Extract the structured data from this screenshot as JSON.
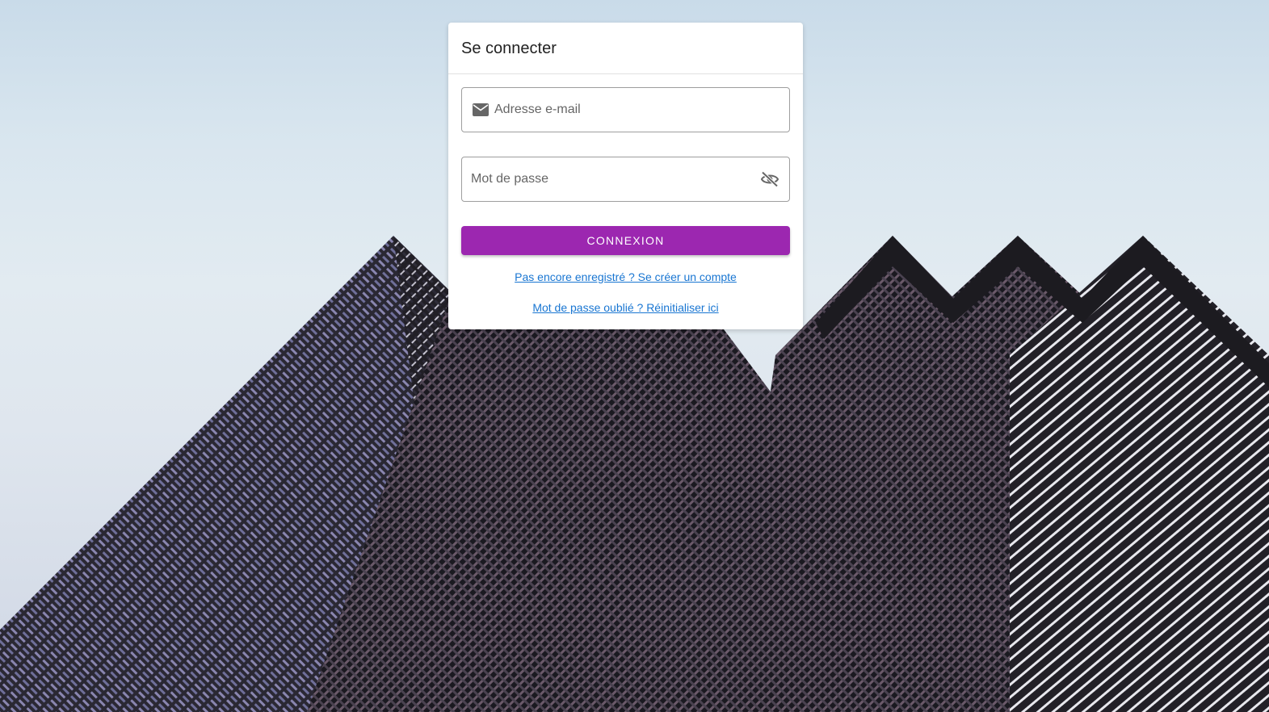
{
  "login": {
    "title": "Se connecter",
    "email_placeholder": "Adresse e-mail",
    "email_value": "",
    "password_placeholder": "Mot de passe",
    "password_value": "",
    "submit_label": "CONNEXION",
    "register_link": "Pas encore enregistré ? Se créer un compte",
    "reset_link": "Mot de passe oublié ? Réinitialiser ici"
  },
  "icons": {
    "email": "mail-icon",
    "password_toggle": "eye-off-icon"
  },
  "colors": {
    "accent": "#9c27b0",
    "link": "#1976d2",
    "card_background": "#ffffff"
  }
}
